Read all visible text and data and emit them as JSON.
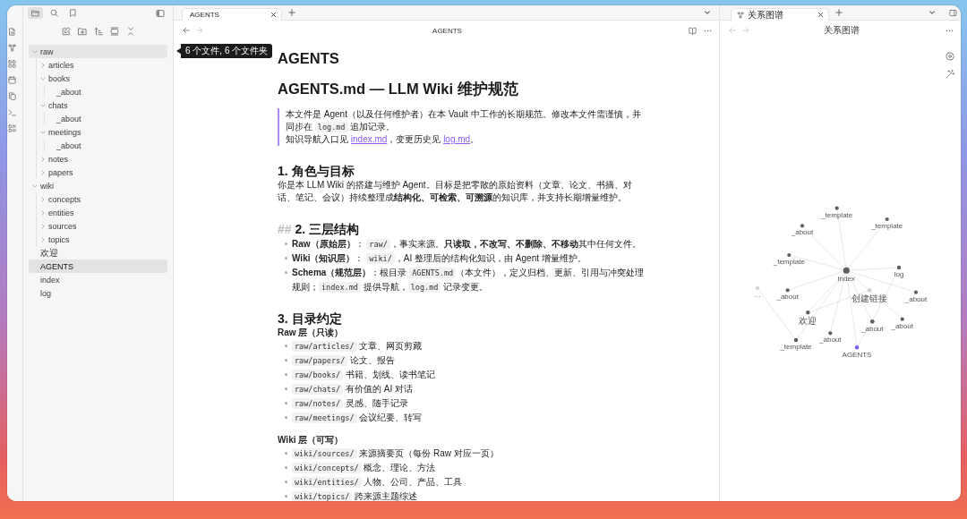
{
  "sidebar": {
    "tabs": [
      {
        "kind": "files",
        "selected": true
      },
      {
        "kind": "search",
        "selected": false
      },
      {
        "kind": "bookmarks",
        "selected": false
      }
    ],
    "tree": [
      {
        "label": "raw",
        "kind": "folder",
        "expanded": true,
        "selected": false,
        "hovered": true,
        "children": [
          {
            "label": "articles",
            "kind": "folder",
            "expanded": false,
            "selected": false,
            "hovered": false
          },
          {
            "label": "books",
            "kind": "folder",
            "expanded": true,
            "selected": false,
            "hovered": false,
            "children": [
              {
                "label": "_about",
                "kind": "file",
                "selected": false,
                "hovered": false
              }
            ]
          },
          {
            "label": "chats",
            "kind": "folder",
            "expanded": true,
            "selected": false,
            "hovered": false,
            "children": [
              {
                "label": "_about",
                "kind": "file",
                "selected": false,
                "hovered": false
              }
            ]
          },
          {
            "label": "meetings",
            "kind": "folder",
            "expanded": true,
            "selected": false,
            "hovered": false,
            "children": [
              {
                "label": "_about",
                "kind": "file",
                "selected": false,
                "hovered": false
              }
            ]
          },
          {
            "label": "notes",
            "kind": "folder",
            "expanded": false,
            "selected": false,
            "hovered": false
          },
          {
            "label": "papers",
            "kind": "folder",
            "expanded": false,
            "selected": false,
            "hovered": false
          }
        ]
      },
      {
        "label": "wiki",
        "kind": "folder",
        "expanded": true,
        "selected": false,
        "hovered": false,
        "children": [
          {
            "label": "concepts",
            "kind": "folder",
            "expanded": false,
            "selected": false,
            "hovered": false
          },
          {
            "label": "entities",
            "kind": "folder",
            "expanded": false,
            "selected": false,
            "hovered": false
          },
          {
            "label": "sources",
            "kind": "folder",
            "expanded": false,
            "selected": false,
            "hovered": false
          },
          {
            "label": "topics",
            "kind": "folder",
            "expanded": false,
            "selected": false,
            "hovered": false
          }
        ]
      },
      {
        "label": "欢迎",
        "kind": "file",
        "selected": false,
        "hovered": false
      },
      {
        "label": "AGENTS",
        "kind": "file",
        "selected": true,
        "hovered": false
      },
      {
        "label": "index",
        "kind": "file",
        "selected": false,
        "hovered": false
      },
      {
        "label": "log",
        "kind": "file",
        "selected": false,
        "hovered": false
      }
    ]
  },
  "tooltip": {
    "text": "6 个文件, 6 个文件夹"
  },
  "editor": {
    "tabs": [
      {
        "label": "AGENTS",
        "selected": true
      }
    ],
    "nav": [
      {
        "kind": "back",
        "disabled": false
      },
      {
        "kind": "forward",
        "disabled": true
      }
    ],
    "title": "AGENTS",
    "document": [
      {
        "kind": "h1",
        "text": "AGENTS"
      },
      {
        "kind": "h1",
        "text": "AGENTS.md — LLM Wiki 维护规范"
      },
      {
        "kind": "quote",
        "lines": [
          {
            "parts": [
              {
                "kind": "text",
                "text": "本文件是 Agent（以及任何维护者）在本 Vault 中工作的长期规范。修改本文件需谨慎，并同步在 "
              },
              {
                "kind": "code",
                "text": "log.md"
              },
              {
                "kind": "text",
                "text": " 追加记录。"
              }
            ]
          },
          {
            "parts": [
              {
                "kind": "text",
                "text": "知识导航入口见 "
              },
              {
                "kind": "link",
                "text": "index.md"
              },
              {
                "kind": "text",
                "text": "，变更历史见 "
              },
              {
                "kind": "link",
                "text": "log.md"
              },
              {
                "kind": "text",
                "text": "。"
              }
            ]
          }
        ]
      },
      {
        "kind": "h2",
        "text": "1. 角色与目标"
      },
      {
        "kind": "paragraph",
        "parts": [
          {
            "kind": "text",
            "text": "你是本 LLM Wiki 的搭建与维护 Agent。目标是把零散的原始资料（文章、论文、书摘、对话、笔记、会议）持续整理成**结构化、可检索、可溯源**的知识库，并支持长期增量维护。"
          }
        ]
      },
      {
        "kind": "h2",
        "prefix": "##",
        "text": "2. 三层结构"
      },
      {
        "kind": "list",
        "items": [
          {
            "parts": [
              {
                "kind": "text",
                "text": "**Raw（原始层）**： "
              },
              {
                "kind": "code",
                "text": "raw/"
              },
              {
                "kind": "text",
                "text": "，事实来源。**只读取，不改写、不删除、不移动**其中任何文件。"
              }
            ]
          },
          {
            "parts": [
              {
                "kind": "text",
                "text": "**Wiki（知识层）**： "
              },
              {
                "kind": "code",
                "text": "wiki/"
              },
              {
                "kind": "text",
                "text": "，AI 整理后的结构化知识，由 Agent 增量维护。"
              }
            ]
          },
          {
            "parts": [
              {
                "kind": "text",
                "text": "**Schema（规范层）**：根目录 "
              },
              {
                "kind": "code",
                "text": "AGENTS.md"
              },
              {
                "kind": "text",
                "text": "（本文件），定义归档、更新、引用与冲突处理规则；"
              },
              {
                "kind": "code",
                "text": "index.md"
              },
              {
                "kind": "text",
                "text": " 提供导航，"
              },
              {
                "kind": "code",
                "text": "log.md"
              },
              {
                "kind": "text",
                "text": " 记录变更。"
              }
            ]
          }
        ]
      },
      {
        "kind": "h2",
        "text": "3. 目录约定"
      },
      {
        "kind": "label",
        "text": "Raw 层（只读）"
      },
      {
        "kind": "list",
        "items": [
          {
            "parts": [
              {
                "kind": "code",
                "text": "raw/articles/"
              },
              {
                "kind": "text",
                "text": " 文章、网页剪藏"
              }
            ]
          },
          {
            "parts": [
              {
                "kind": "code",
                "text": "raw/papers/"
              },
              {
                "kind": "text",
                "text": " 论文、报告"
              }
            ]
          },
          {
            "parts": [
              {
                "kind": "code",
                "text": "raw/books/"
              },
              {
                "kind": "text",
                "text": " 书籍、划线、读书笔记"
              }
            ]
          },
          {
            "parts": [
              {
                "kind": "code",
                "text": "raw/chats/"
              },
              {
                "kind": "text",
                "text": " 有价值的 AI 对话"
              }
            ]
          },
          {
            "parts": [
              {
                "kind": "code",
                "text": "raw/notes/"
              },
              {
                "kind": "text",
                "text": " 灵感、随手记录"
              }
            ]
          },
          {
            "parts": [
              {
                "kind": "code",
                "text": "raw/meetings/"
              },
              {
                "kind": "text",
                "text": " 会议纪要、转写"
              }
            ]
          }
        ]
      },
      {
        "kind": "label",
        "text": "Wiki 层（可写）"
      },
      {
        "kind": "list",
        "items": [
          {
            "parts": [
              {
                "kind": "code",
                "text": "wiki/sources/"
              },
              {
                "kind": "text",
                "text": " 来源摘要页（每份 Raw 对应一页）"
              }
            ]
          },
          {
            "parts": [
              {
                "kind": "code",
                "text": "wiki/concepts/"
              },
              {
                "kind": "text",
                "text": " 概念、理论、方法"
              }
            ]
          },
          {
            "parts": [
              {
                "kind": "code",
                "text": "wiki/entities/"
              },
              {
                "kind": "text",
                "text": " 人物、公司、产品、工具"
              }
            ]
          },
          {
            "parts": [
              {
                "kind": "code",
                "text": "wiki/topics/"
              },
              {
                "kind": "text",
                "text": " 跨来源主题综述"
              }
            ]
          }
        ]
      }
    ]
  },
  "graph_pane": {
    "tabs": [
      {
        "label": "关系图谱",
        "selected": true
      }
    ],
    "nav": [
      {
        "kind": "back",
        "disabled": true
      },
      {
        "kind": "forward",
        "disabled": true
      }
    ],
    "title": "关系图谱",
    "nodes": [
      {
        "label": "_template",
        "kind": "note"
      },
      {
        "label": "_template",
        "kind": "note"
      },
      {
        "label": "_about",
        "kind": "note"
      },
      {
        "label": "_template",
        "kind": "note"
      },
      {
        "label": "index",
        "kind": "note"
      },
      {
        "label": "log",
        "kind": "note"
      },
      {
        "label": "…",
        "kind": "unresolved"
      },
      {
        "label": "_about",
        "kind": "note"
      },
      {
        "label": "创建链接",
        "kind": "unresolved"
      },
      {
        "label": "_about",
        "kind": "note"
      },
      {
        "label": "欢迎",
        "kind": "note"
      },
      {
        "label": "_about",
        "kind": "note"
      },
      {
        "label": "_about",
        "kind": "note"
      },
      {
        "label": "_about",
        "kind": "note"
      },
      {
        "label": "_template",
        "kind": "note"
      },
      {
        "label": "AGENTS",
        "kind": "active"
      }
    ]
  }
}
